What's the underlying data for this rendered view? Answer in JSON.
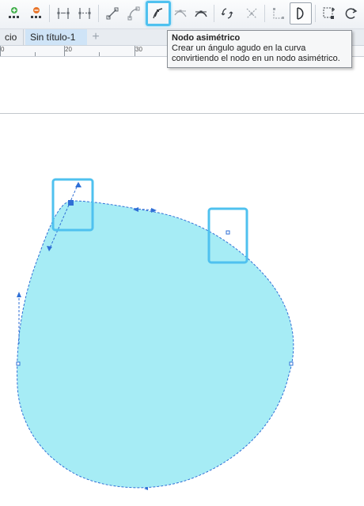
{
  "toolbar": {
    "items": [
      {
        "name": "add-node-icon"
      },
      {
        "name": "delete-node-icon"
      },
      {
        "name": "join-nodes-icon"
      },
      {
        "name": "break-curve-icon"
      },
      {
        "name": "to-line-icon"
      },
      {
        "name": "to-curve-icon"
      },
      {
        "name": "cusp-node-icon"
      },
      {
        "name": "smooth-node-icon"
      },
      {
        "name": "symmetrical-node-icon"
      },
      {
        "name": "reverse-direction-icon"
      },
      {
        "name": "extend-curve-icon"
      },
      {
        "name": "extract-subpath-icon"
      },
      {
        "name": "close-curve-icon"
      },
      {
        "name": "select-all-nodes-icon"
      },
      {
        "name": "rotate-nodes-icon"
      }
    ],
    "highlight_color": "#4fc1ef"
  },
  "tabs": {
    "previous_label": "cio",
    "active_label": "Sin título-1",
    "add_label": "+"
  },
  "ruler": {
    "labels": [
      "0",
      "20",
      "30"
    ]
  },
  "tooltip": {
    "title": "Nodo asimétrico",
    "body_line1": "Crear un ángulo agudo en la curva",
    "body_line2": "convirtiendo el nodo en un nodo asimétrico."
  },
  "canvas": {
    "shape_fill": "#a6ecf5",
    "outline_color": "#2f6fd6",
    "highlight_color": "#4fc1ef"
  }
}
